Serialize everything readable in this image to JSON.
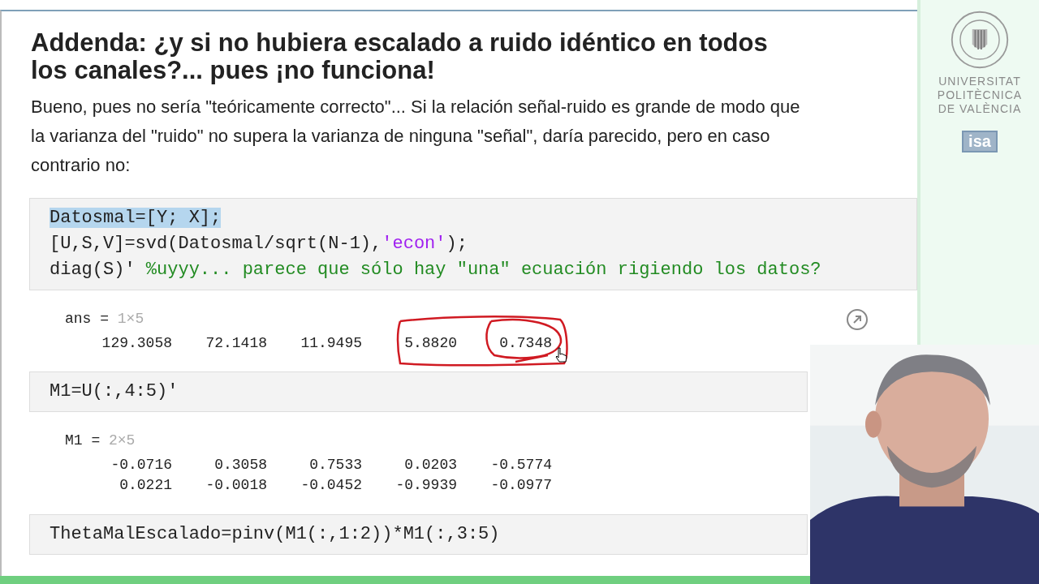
{
  "heading": "Addenda: ¿y si no hubiera escalado a ruido idéntico en todos los canales?... pues ¡no funciona!",
  "paragraph": "Bueno, pues no sería \"teóricamente correcto\"... Si la relación señal-ruido es grande de modo que la varianza del \"ruido\" no supera la varianza de ninguna \"señal\", daría parecido, pero en caso contrario no:",
  "cells": [
    {
      "kind": "code",
      "lines": [
        {
          "selected": true,
          "segments": [
            {
              "kind": "plain",
              "text": "Datosmal=[Y; X];"
            }
          ]
        },
        {
          "selected": false,
          "segments": [
            {
              "kind": "plain",
              "text": "[U,S,V]=svd(Datosmal/sqrt(N-1),"
            },
            {
              "kind": "string",
              "text": "'econ'"
            },
            {
              "kind": "plain",
              "text": ");"
            }
          ]
        },
        {
          "selected": false,
          "segments": [
            {
              "kind": "plain",
              "text": "diag(S)' "
            },
            {
              "kind": "comment",
              "text": "%uyyy... parece que sólo hay \"una\" ecuación rigiendo los datos?"
            }
          ]
        }
      ]
    },
    {
      "kind": "output",
      "name": "ans",
      "equals": "=",
      "size": "1×5",
      "annotated": true,
      "rows": [
        [
          "129.3058",
          "72.1418",
          "11.9495",
          "5.8820",
          "0.7348"
        ]
      ]
    },
    {
      "kind": "code",
      "lines": [
        {
          "selected": false,
          "segments": [
            {
              "kind": "plain",
              "text": "M1=U(:,4:5)'"
            }
          ]
        }
      ]
    },
    {
      "kind": "output",
      "name": "M1",
      "equals": "=",
      "size": "2×5",
      "rows": [
        [
          "-0.0716",
          "0.3058",
          "0.7533",
          "0.0203",
          "-0.5774"
        ],
        [
          "0.0221",
          "-0.0018",
          "-0.0452",
          "-0.9939",
          "-0.0977"
        ]
      ]
    },
    {
      "kind": "code",
      "lines": [
        {
          "selected": false,
          "segments": [
            {
              "kind": "plain",
              "text": "ThetaMalEscalado=pinv(M1(:,1:2))*M1(:,3:5)"
            }
          ]
        }
      ]
    }
  ],
  "logo": {
    "lines": [
      "UNIVERSITAT",
      "POLITÈCNICA",
      "DE VALÈNCIA"
    ],
    "badge": "isa"
  }
}
